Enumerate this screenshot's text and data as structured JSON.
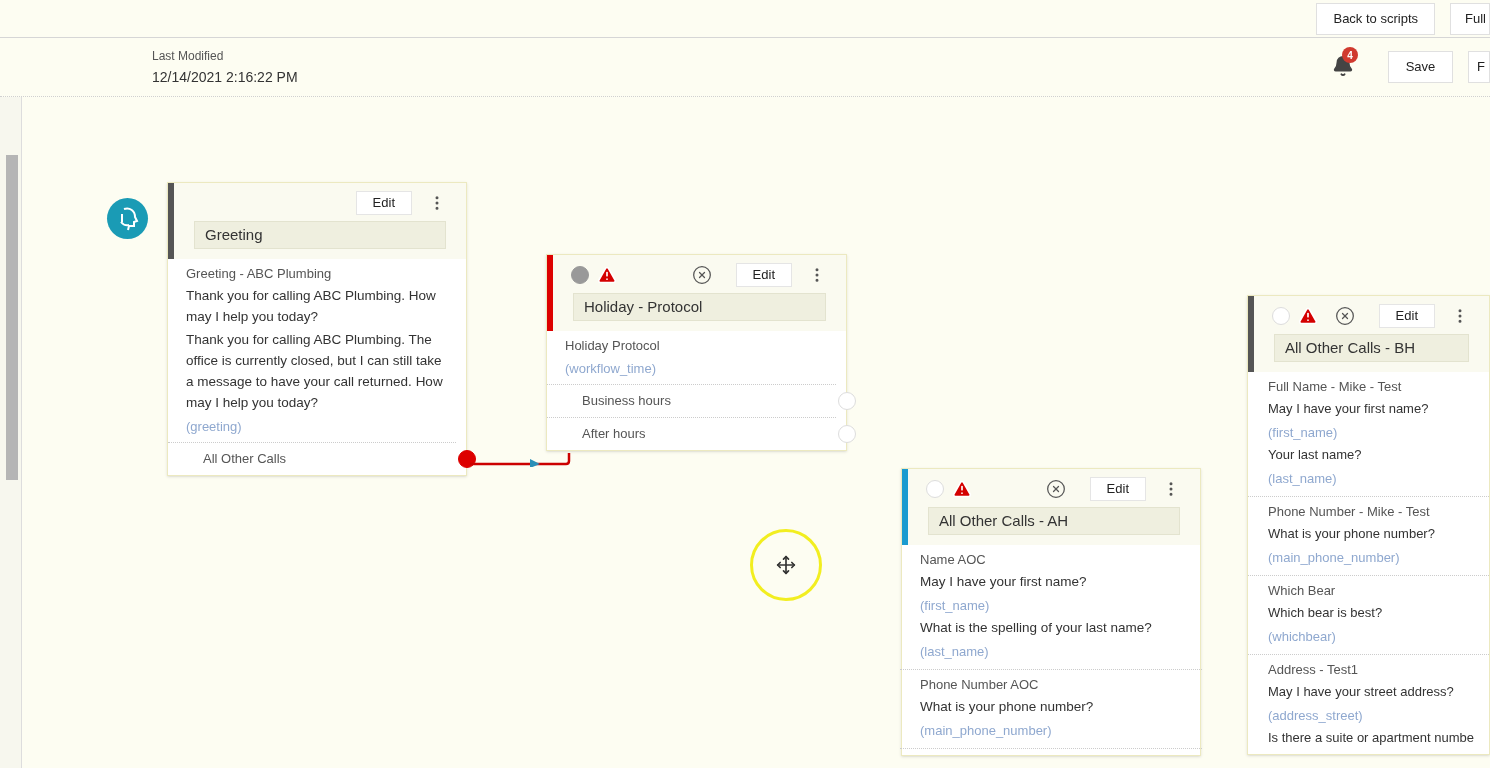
{
  "top_bar": {
    "buttons": [
      "Back to scripts",
      "Full"
    ]
  },
  "header": {
    "last_modified_label": "Last Modified",
    "last_modified_value": "12/14/2021 2:16:22 PM",
    "notification_count": "4",
    "buttons": [
      "Save",
      "F"
    ]
  },
  "nodes": [
    {
      "kind": "start",
      "title": "Greeting",
      "color": "#555555",
      "edit": "Edit",
      "items": [
        {
          "kind": "label",
          "text": "Greeting - ABC Plumbing"
        },
        {
          "kind": "prompt",
          "text": "Thank you for calling ABC Plumbing. How may I help you today?"
        },
        {
          "kind": "prompt",
          "text": "Thank you for calling ABC Plumbing. The office is currently closed, but I can still take a message to have your call returned. How may I help you today?"
        },
        {
          "kind": "variable",
          "text": "(greeting)"
        }
      ],
      "outputs": [
        {
          "label": "All Other Calls",
          "connected": true
        }
      ]
    },
    {
      "kind": "step",
      "title": "Holiday - Protocol",
      "color": "#dd0000",
      "edit": "Edit",
      "warning": true,
      "connected": true,
      "items": [
        {
          "kind": "label",
          "text": "Holiday Protocol"
        },
        {
          "kind": "variable",
          "text": "(workflow_time)"
        }
      ],
      "outputs": [
        {
          "label": "Business hours",
          "connected": false
        },
        {
          "label": "After hours",
          "connected": false
        }
      ]
    },
    {
      "kind": "step",
      "title": "All Other Calls - AH",
      "color": "#1a9bd0",
      "edit": "Edit",
      "warning": true,
      "connected": false,
      "items": [
        {
          "kind": "label",
          "text": "Name AOC"
        },
        {
          "kind": "prompt",
          "text": "May I have your first name?"
        },
        {
          "kind": "variable",
          "text": "(first_name)"
        },
        {
          "kind": "prompt",
          "text": "What is the spelling of your last name?"
        },
        {
          "kind": "variable",
          "text": "(last_name)"
        },
        {
          "kind": "divider"
        },
        {
          "kind": "label",
          "text": "Phone Number AOC"
        },
        {
          "kind": "prompt",
          "text": "What is your phone number?"
        },
        {
          "kind": "variable",
          "text": "(main_phone_number)"
        },
        {
          "kind": "divider"
        }
      ]
    },
    {
      "kind": "step",
      "title": "All Other Calls - BH",
      "color": "#555555",
      "edit": "Edit",
      "warning": true,
      "connected": false,
      "items": [
        {
          "kind": "label",
          "text": "Full Name - Mike - Test"
        },
        {
          "kind": "prompt",
          "text": "May I have your first name?"
        },
        {
          "kind": "variable",
          "text": "(first_name)"
        },
        {
          "kind": "prompt",
          "text": "Your last name?"
        },
        {
          "kind": "variable",
          "text": "(last_name)"
        },
        {
          "kind": "divider"
        },
        {
          "kind": "label",
          "text": "Phone Number - Mike - Test"
        },
        {
          "kind": "prompt",
          "text": "What is your phone number?"
        },
        {
          "kind": "variable",
          "text": "(main_phone_number)"
        },
        {
          "kind": "divider"
        },
        {
          "kind": "label",
          "text": "Which Bear"
        },
        {
          "kind": "prompt",
          "text": "Which bear is best?"
        },
        {
          "kind": "variable",
          "text": "(whichbear)"
        },
        {
          "kind": "divider"
        },
        {
          "kind": "label",
          "text": "Address - Test1"
        },
        {
          "kind": "prompt",
          "text": "May I have your street address?"
        },
        {
          "kind": "variable",
          "text": "(address_street)"
        },
        {
          "kind": "prompt",
          "text": "Is there a suite or apartment numbe"
        }
      ]
    }
  ]
}
